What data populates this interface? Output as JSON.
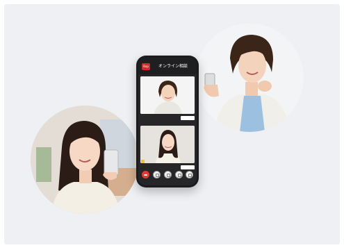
{
  "phone": {
    "app_title": "オンライン相談",
    "logo_text": "Bop"
  },
  "colors": {
    "background": "#eef0f3",
    "phone_body": "#1b1b1d",
    "end_call_red": "#e03a33",
    "logo_red": "#d3282d"
  },
  "icons": {
    "end_call": "phone-hangup-icon",
    "mic": "microphone-icon",
    "camera": "camera-icon",
    "speaker": "speaker-icon",
    "more": "more-icon"
  }
}
